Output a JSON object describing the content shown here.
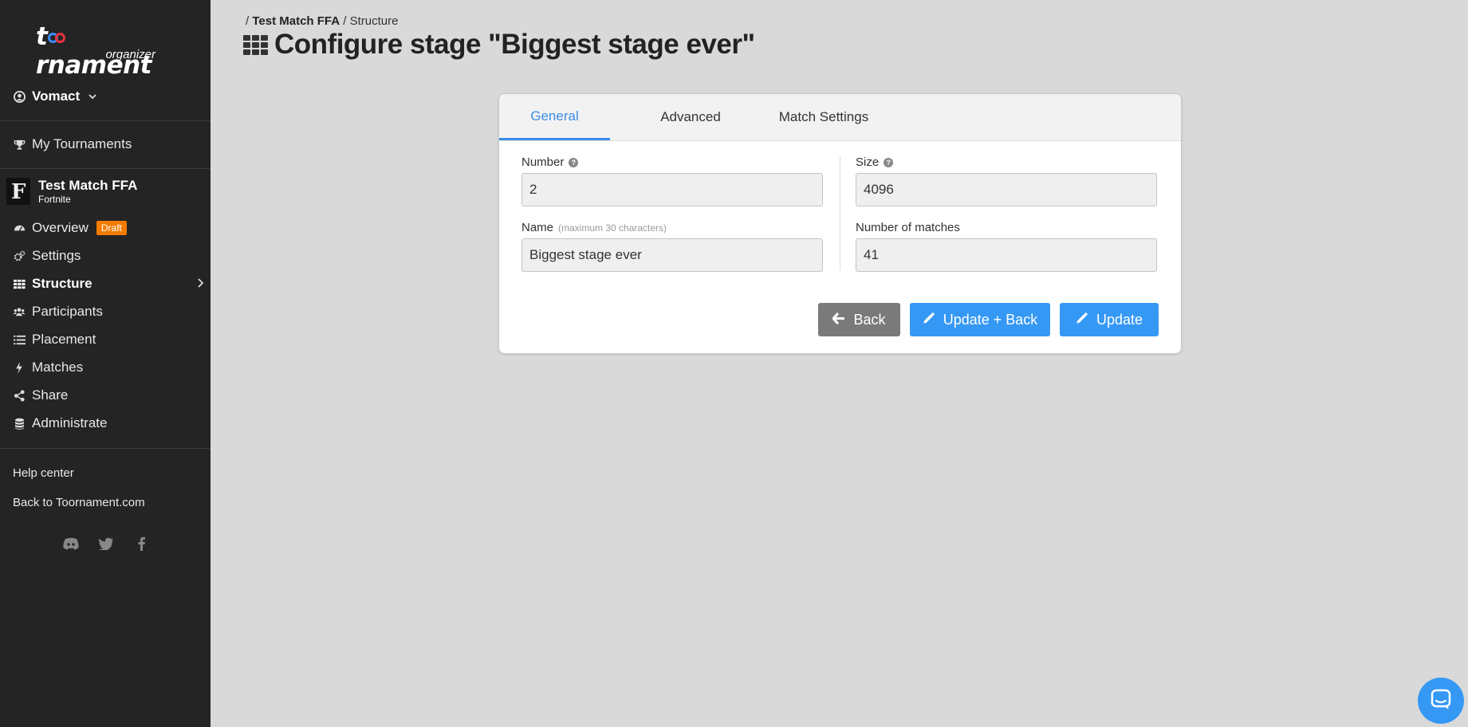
{
  "app": {
    "logo_main": "toornament",
    "logo_sub": "organizer"
  },
  "sidebar": {
    "user": {
      "name": "Vomact",
      "icon": "user-circle-icon"
    },
    "my_tournaments": {
      "label": "My Tournaments",
      "icon": "trophy-icon"
    },
    "tournament": {
      "name": "Test Match FFA",
      "game": "Fortnite",
      "thumb_letter": "F"
    },
    "items": [
      {
        "label": "Overview",
        "icon": "dashboard-icon",
        "badge": "Draft"
      },
      {
        "label": "Settings",
        "icon": "cogs-icon"
      },
      {
        "label": "Structure",
        "icon": "grid-icon",
        "active": true
      },
      {
        "label": "Participants",
        "icon": "users-icon"
      },
      {
        "label": "Placement",
        "icon": "list-icon"
      },
      {
        "label": "Matches",
        "icon": "bolt-icon"
      },
      {
        "label": "Share",
        "icon": "share-icon"
      },
      {
        "label": "Administrate",
        "icon": "database-icon"
      }
    ],
    "help_center": "Help center",
    "back_link": "Back to Toornament.com",
    "socials": [
      "discord-icon",
      "twitter-icon",
      "facebook-icon"
    ]
  },
  "breadcrumb": {
    "sep": "/",
    "tournament": "Test Match FFA",
    "section": "Structure"
  },
  "page": {
    "title": "Configure stage \"Biggest stage ever\""
  },
  "tabs": [
    "General",
    "Advanced",
    "Match Settings"
  ],
  "form": {
    "number": {
      "label": "Number",
      "value": "2"
    },
    "size": {
      "label": "Size",
      "value": "4096"
    },
    "name": {
      "label": "Name",
      "hint": "(maximum 30 characters)",
      "value": "Biggest stage ever"
    },
    "matches": {
      "label": "Number of matches",
      "value": "41"
    }
  },
  "buttons": {
    "back": "Back",
    "update_back": "Update + Back",
    "update": "Update"
  },
  "colors": {
    "sidebar_bg": "#242424",
    "accent": "#3598f5",
    "draft_badge": "#f57c00",
    "page_bg": "#d9d9d9"
  }
}
